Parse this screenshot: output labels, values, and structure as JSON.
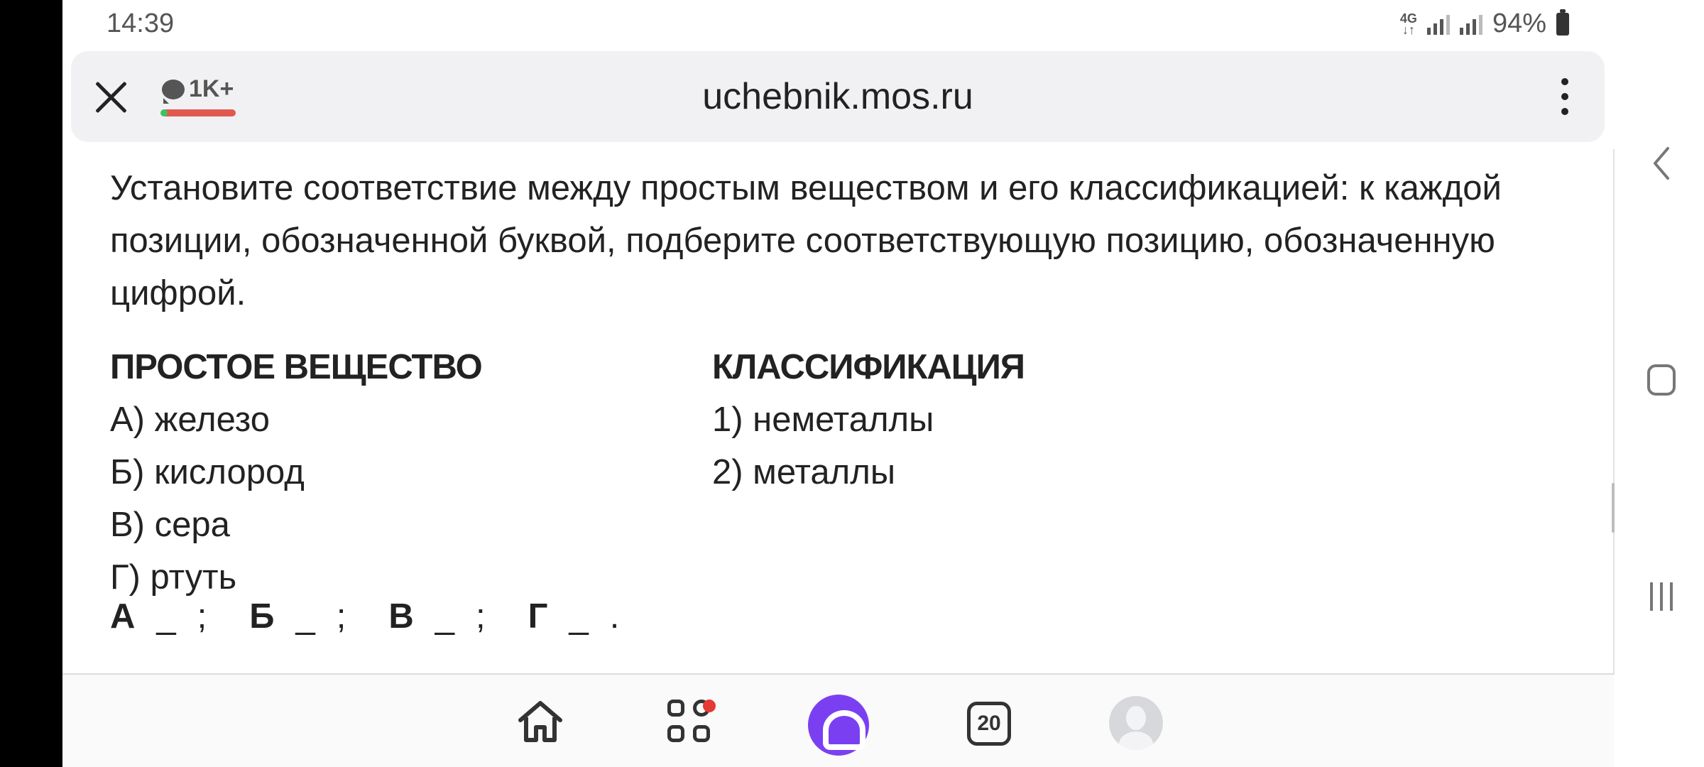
{
  "status_bar": {
    "time": "14:39",
    "network": "4G",
    "battery": "94%"
  },
  "browser": {
    "url": "uchebnik.mos.ru",
    "comments_count": "1K+",
    "tabs_count": "20"
  },
  "task": {
    "question": "Установите соответствие между простым веществом и его классификацией: к каждой позиции, обозначенной буквой, подберите соответствующую позицию, обозначенную цифрой.",
    "left_header": "ПРОСТОЕ ВЕЩЕСТВО",
    "right_header": "КЛАССИФИКАЦИЯ",
    "left_items": [
      "А) железо",
      "Б) кислород",
      "В) сера",
      "Г) ртуть"
    ],
    "right_items": [
      "1) неметаллы",
      "2) металлы"
    ],
    "answers": [
      {
        "letter": "А",
        "blank": "_",
        "sep": ";"
      },
      {
        "letter": "Б",
        "blank": "_",
        "sep": ";"
      },
      {
        "letter": "В",
        "blank": "_",
        "sep": ";"
      },
      {
        "letter": "Г",
        "blank": "_",
        "sep": "."
      }
    ]
  },
  "colors": {
    "alice": "#7b3ff2",
    "notification": "#e53935",
    "comments_bar": "#e05a4f"
  }
}
